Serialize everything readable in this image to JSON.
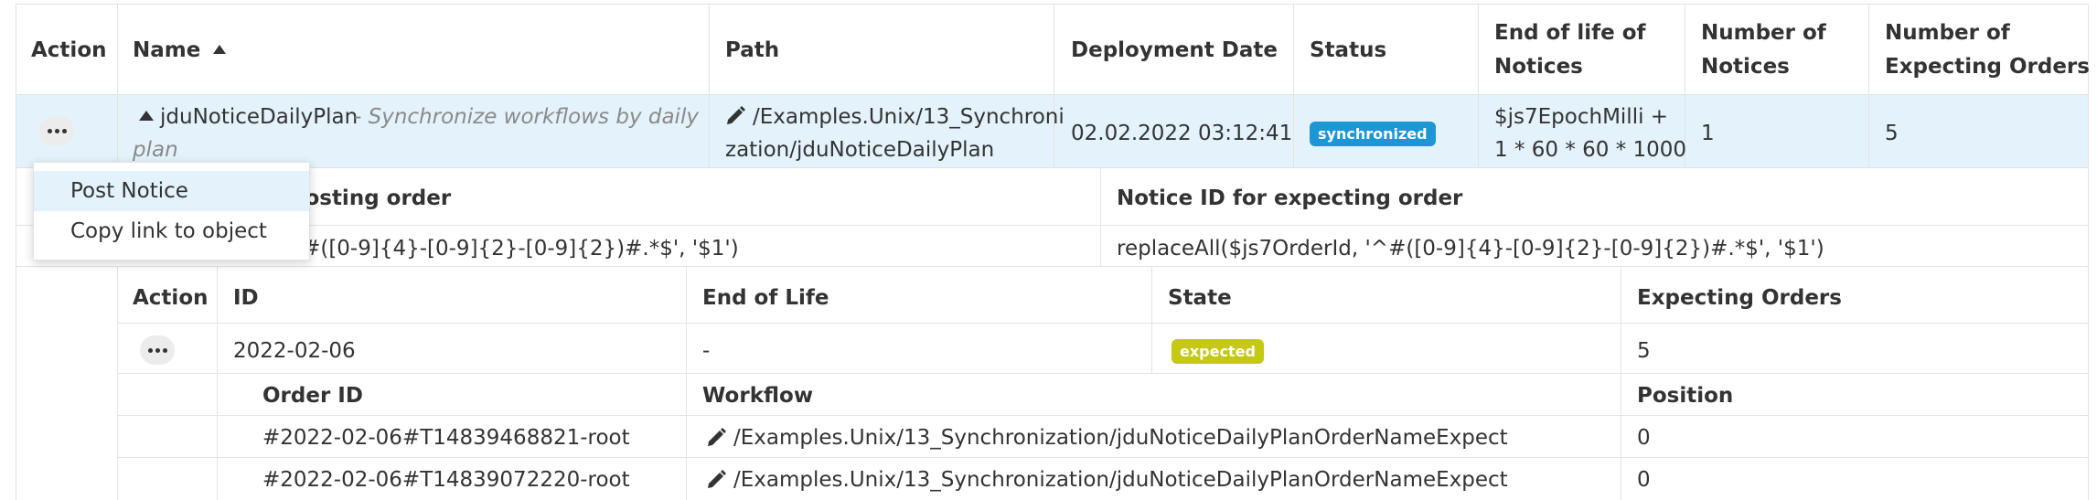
{
  "table": {
    "headers": {
      "action": "Action",
      "name": "Name",
      "path": "Path",
      "deployment_date": "Deployment Date",
      "status": "Status",
      "end_of_life_1": "End of life of",
      "end_of_life_2": "Notices",
      "number_notices_1": "Number of",
      "number_notices_2": "Notices",
      "number_expecting_1": "Number of",
      "number_expecting_2": "Expecting Orders"
    },
    "row": {
      "name": "jduNoticeDailyPlan",
      "title_line1": "- Synchronize workflows by daily",
      "title_line2": "plan",
      "path_line1": "/Examples.Unix/13_Synchroni",
      "path_line2": "zation/jduNoticeDailyPlan",
      "deployment_date": "02.02.2022 03:12:41",
      "status": "synchronized",
      "end_of_life_1": "$js7EpochMilli +",
      "end_of_life_2": "1 * 60 * 60 * 1000",
      "number_notices": "1",
      "number_expecting": "5"
    }
  },
  "notice_ids": {
    "header_left": "Notice ID for posting order",
    "header_right": "Notice ID for expecting order",
    "value_left": "replaceAll($js7OrderId, '^#([0-9]{4}-[0-9]{2}-[0-9]{2})#.*$', '$1')",
    "value_right": "replaceAll($js7OrderId, '^#([0-9]{4}-[0-9]{2}-[0-9]{2})#.*$', '$1')"
  },
  "notices": {
    "headers": {
      "action": "Action",
      "id": "ID",
      "end_of_life": "End of Life",
      "state": "State",
      "expecting_orders": "Expecting Orders"
    },
    "row": {
      "id": "2022-02-06",
      "end_of_life": "-",
      "state": "expected",
      "expecting_orders": "5"
    },
    "orders": {
      "headers": {
        "order_id": "Order ID",
        "workflow": "Workflow",
        "position": "Position"
      },
      "rows": [
        {
          "order_id": "#2022-02-06#T14839468821-root",
          "workflow": "/Examples.Unix/13_Synchronization/jduNoticeDailyPlanOrderNameExpect",
          "position": "0"
        },
        {
          "order_id": "#2022-02-06#T14839072220-root",
          "workflow": "/Examples.Unix/13_Synchronization/jduNoticeDailyPlanOrderNameExpect",
          "position": "0"
        }
      ]
    }
  },
  "context_menu": {
    "items": [
      "Post Notice",
      "Copy link to object"
    ]
  },
  "colors": {
    "selected_row": "#e3f2fb",
    "synchronized_badge": "#1c96d4",
    "expected_badge": "#c5c914"
  }
}
